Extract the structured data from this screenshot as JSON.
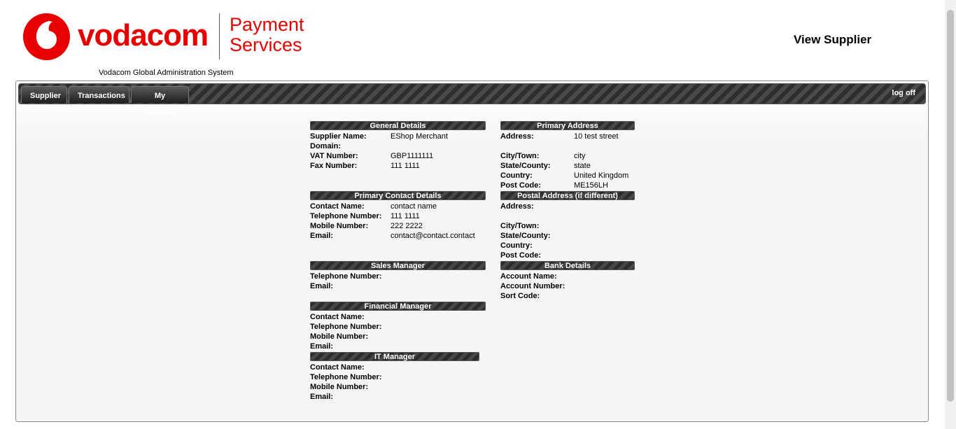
{
  "header": {
    "brand": "vodacom",
    "product_line1": "Payment",
    "product_line2": "Services",
    "system_name": "Vodacom Global Administration System",
    "page_title": "View Supplier"
  },
  "nav": {
    "tabs": [
      "Supplier",
      "Transactions",
      "My Account"
    ],
    "logoff": "log off"
  },
  "general": {
    "title": "General Details",
    "supplier_name_label": "Supplier Name:",
    "supplier_name": "EShop Merchant",
    "domain_label": "Domain:",
    "domain": "",
    "vat_label": "VAT Number:",
    "vat": "GBP1111111",
    "fax_label": "Fax Number:",
    "fax": "111 1111"
  },
  "primary_contact": {
    "title": "Primary Contact Details",
    "name_label": "Contact Name:",
    "name": "contact name",
    "tel_label": "Telephone Number:",
    "tel": "111 1111",
    "mobile_label": "Mobile Number:",
    "mobile": "222 2222",
    "email_label": "Email:",
    "email": "contact@contact.contact"
  },
  "sales_manager": {
    "title": "Sales Manager",
    "tel_label": "Telephone Number:",
    "email_label": "Email:"
  },
  "financial_manager": {
    "title": "Financial Manager",
    "name_label": "Contact Name:",
    "tel_label": "Telephone Number:",
    "mobile_label": "Mobile Number:",
    "email_label": "Email:"
  },
  "it_manager": {
    "title": "IT Manager",
    "name_label": "Contact Name:",
    "tel_label": "Telephone Number:",
    "mobile_label": "Mobile Number:",
    "email_label": "Email:"
  },
  "primary_address": {
    "title": "Primary Address",
    "address_label": "Address:",
    "address": "10 test street",
    "city_label": "City/Town:",
    "city": "city",
    "state_label": "State/County:",
    "state": "state",
    "country_label": "Country:",
    "country": "United Kingdom",
    "post_label": "Post Code:",
    "post": "ME156LH"
  },
  "postal_address": {
    "title": "Postal Address (if different)",
    "address_label": "Address:",
    "city_label": "City/Town:",
    "state_label": "State/County:",
    "country_label": "Country:",
    "post_label": "Post Code:"
  },
  "bank": {
    "title": "Bank Details",
    "account_name_label": "Account Name:",
    "account_number_label": "Account Number:",
    "sort_code_label": "Sort Code:"
  },
  "colors": {
    "brand_red": "#e60000",
    "nav_dark": "#2e2e2e"
  }
}
